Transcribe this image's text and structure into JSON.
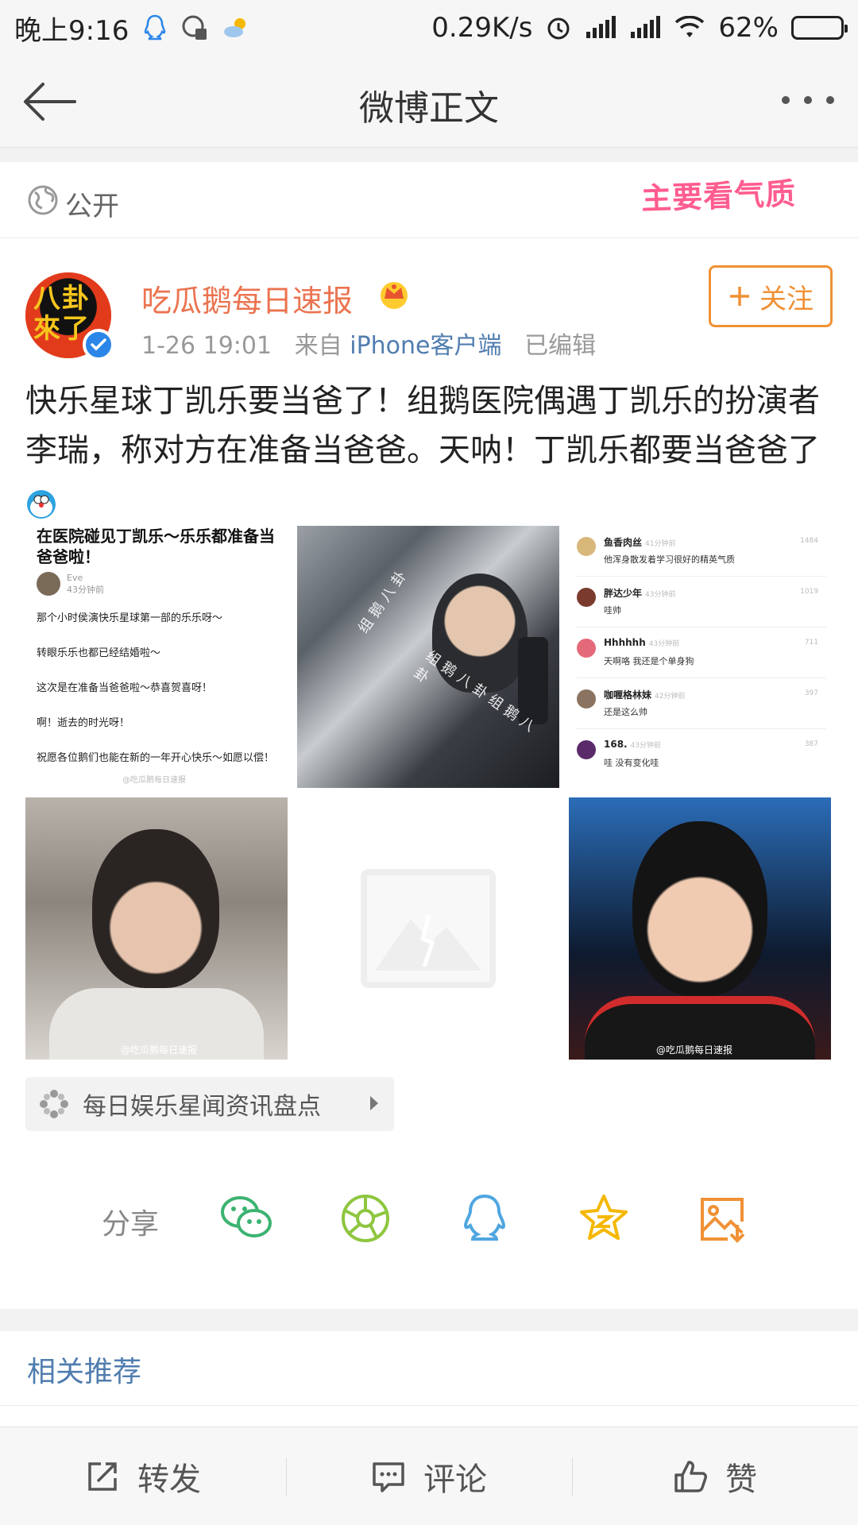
{
  "status_bar": {
    "time": "晚上9:16",
    "speed": "0.29K/s",
    "battery": "62%",
    "battery_level": 0.62
  },
  "nav": {
    "title": "微博正文"
  },
  "visibility": {
    "label": "公开",
    "decoration": "主要看气质"
  },
  "post": {
    "author": "吃瓜鹅每日速报",
    "avatar_text": "八卦\n來了",
    "time": "1-26 19:01",
    "source_prefix": "来自",
    "source": "iPhone客户端",
    "edited": "已编辑",
    "follow_label": "关注",
    "text": "快乐星球丁凯乐要当爸了！组鹅医院偶遇丁凯乐的扮演者李瑞，称对方在准备当爸爸。天呐！丁凯乐都要当爸爸了"
  },
  "image1": {
    "headline": "在医院碰见丁凯乐～乐乐都准备当爸爸啦！",
    "author": "Eve",
    "time": "43分钟前",
    "lines": [
      "那个小时侯演快乐星球第一部的乐乐呀～",
      "转眼乐乐也都已经结婚啦～",
      "这次是在准备当爸爸啦～恭喜贺喜呀！",
      "啊！逝去的时光呀！",
      "祝愿各位鹅们也能在新的一年开心快乐～如愿以偿！"
    ],
    "watermark": "@吃瓜鹅每日速报"
  },
  "image2": {
    "watermark_a": "组鹅八卦",
    "watermark_b": "组鹅八卦组鹅八卦"
  },
  "comments": [
    {
      "name": "鱼香肉丝",
      "time": "41分钟前",
      "text": "他浑身散发着学习很好的精英气质",
      "likes": "1484",
      "color": "#d8b77a"
    },
    {
      "name": "胖达少年",
      "time": "43分钟前",
      "text": "哇帅",
      "likes": "1019",
      "color": "#7a3b2e"
    },
    {
      "name": "Hhhhhh",
      "time": "43分钟前",
      "text": "天啊咯 我还是个单身狗",
      "likes": "711",
      "color": "#e46a7a"
    },
    {
      "name": "咖喱格林妹",
      "time": "42分钟前",
      "text": "还是这么帅",
      "likes": "397",
      "color": "#8a7360"
    },
    {
      "name": "168.",
      "time": "43分钟前",
      "text": "哇 没有变化哇",
      "likes": "387",
      "color": "#5b2a6a"
    }
  ],
  "image4": {
    "watermark": "@吃瓜鹅每日速报"
  },
  "image6": {
    "watermark": "@吃瓜鹅每日速报"
  },
  "topic": {
    "label": "每日娱乐星闻资讯盘点"
  },
  "share": {
    "label": "分享",
    "targets": [
      "wechat-icon",
      "moments-icon",
      "qq-icon",
      "qzone-icon",
      "save-image-icon"
    ]
  },
  "related": {
    "title": "相关推荐"
  },
  "bottom_bar": {
    "repost": "转发",
    "comment": "评论",
    "like": "赞"
  },
  "colors": {
    "accent_orange": "#eb7350",
    "follow_orange": "#f09135",
    "link_blue": "#507daf",
    "wechat_green": "#3cb371",
    "moments_green": "#8ec63f",
    "qq_blue": "#4fa6e0",
    "qzone_yellow": "#f5b700",
    "save_orange": "#f09135"
  }
}
